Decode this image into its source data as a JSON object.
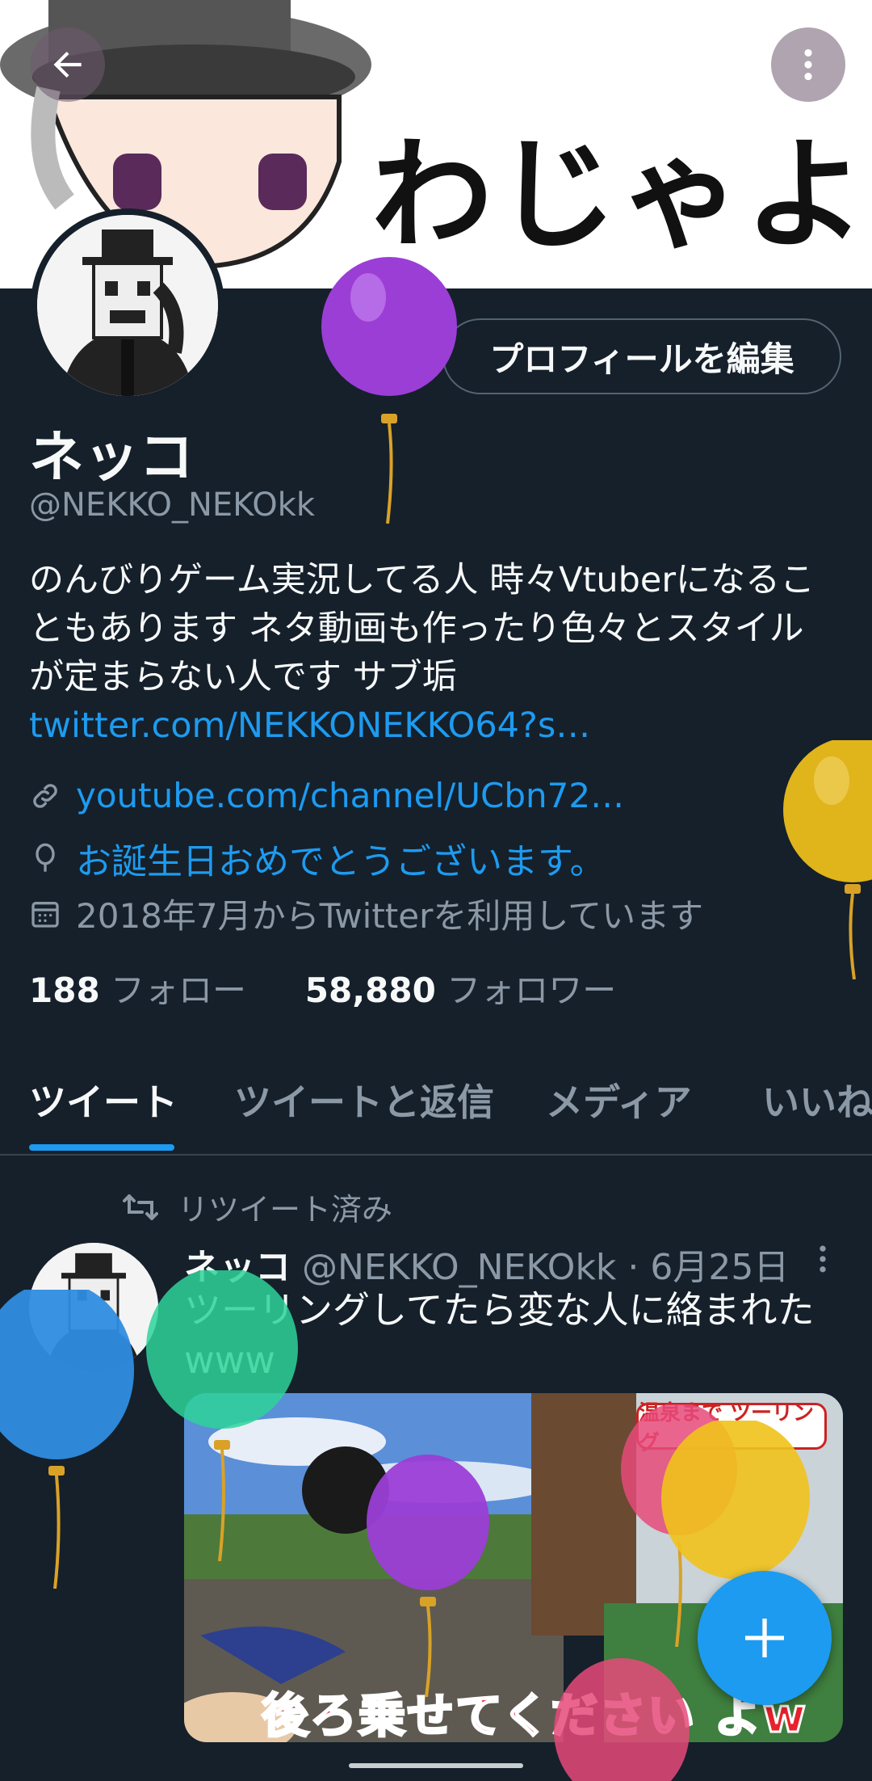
{
  "banner": {
    "text": "わじゃよ"
  },
  "profile": {
    "edit_button": "プロフィールを編集",
    "display_name": "ネッコ",
    "handle": "@NEKKO_NEKOkk",
    "bio_text": "のんびりゲーム実況してる人 時々Vtuberになることもあります ネタ動画も作ったり色々とスタイルが定まらない人です サブ垢 ",
    "bio_link": "twitter.com/NEKKONEKKO64?s…",
    "website": "youtube.com/channel/UCbn72…",
    "birthday": "お誕生日おめでとうございます。",
    "joined": "2018年7月からTwitterを利用しています",
    "following_count": "188",
    "following_label": "フォロー",
    "followers_count": "58,880",
    "followers_label": "フォロワー"
  },
  "tabs": [
    {
      "label": "ツイート"
    },
    {
      "label": "ツイートと返信"
    },
    {
      "label": "メディア"
    },
    {
      "label": "いいね"
    }
  ],
  "tweet": {
    "retweet_label": "リツイート済み",
    "name": "ネッコ",
    "handle": "@NEKKO_NEKOkk",
    "date": "6月25日",
    "text": "ツーリングしてたら変な人に絡まれたwww",
    "media_caption": "後ろ乗せてください よw",
    "media_tag": "温泉まで ツーリング"
  },
  "colors": {
    "accent": "#1d9bf0",
    "background": "#15202b",
    "muted": "#8b98a5"
  },
  "icons": [
    "arrow-left-icon",
    "more-vertical-icon",
    "link-icon",
    "balloon-icon",
    "calendar-icon",
    "retweet-icon",
    "plus-icon"
  ]
}
